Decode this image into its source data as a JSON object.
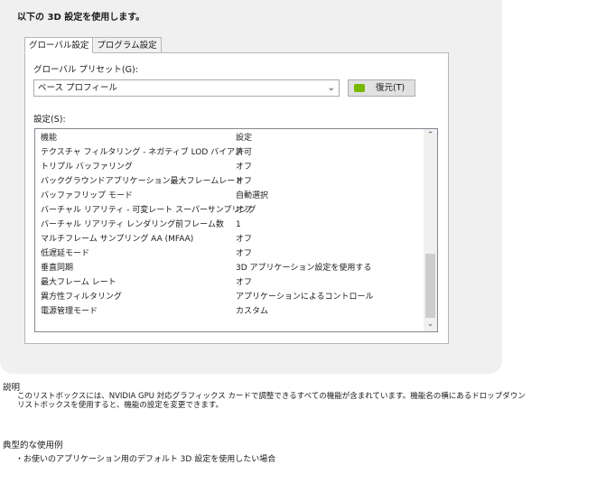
{
  "heading": "以下の 3D 設定を使用します。",
  "tabs": [
    {
      "label": "グローバル設定",
      "active": true
    },
    {
      "label": "プログラム設定",
      "active": false
    }
  ],
  "preset": {
    "label": "グローバル プリセット(G):",
    "selected": "ベース プロフィール",
    "restore_label": "復元(T)"
  },
  "settings": {
    "label": "設定(S):",
    "columns": [
      "機能",
      "設定"
    ],
    "rows": [
      {
        "feature": "テクスチャ フィルタリング - ネガティブ LOD バイアス",
        "value": "許可"
      },
      {
        "feature": "トリプル バッファリング",
        "value": "オフ"
      },
      {
        "feature": "バックグラウンドアプリケーション最大フレームレート",
        "value": "オフ"
      },
      {
        "feature": "バッファフリップ モード",
        "value": "自動選択"
      },
      {
        "feature": "バーチャル リアリティ - 可変レート スーパーサンプリング",
        "value": "オフ"
      },
      {
        "feature": "バーチャル リアリティ レンダリング前フレーム数",
        "value": "1"
      },
      {
        "feature": "マルチフレーム サンプリング AA (MFAA)",
        "value": "オフ"
      },
      {
        "feature": "低遅延モード",
        "value": "オフ"
      },
      {
        "feature": "垂直同期",
        "value": "3D アプリケーション設定を使用する"
      },
      {
        "feature": "最大フレーム レート",
        "value": "オフ"
      },
      {
        "feature": "異方性フィルタリング",
        "value": "アプリケーションによるコントロール"
      },
      {
        "feature": "電源管理モード",
        "value": "カスタム"
      }
    ]
  },
  "description": {
    "title": "説明",
    "text": "このリストボックスには、NVIDIA GPU 対応グラフィックス カードで調整できるすべての機能が含まれています。機能名の横にあるドロップダウン リストボックスを使用すると、機能の設定を変更できます。"
  },
  "usage": {
    "title": "典型的な使用例",
    "item": "・お使いのアプリケーション用のデフォルト 3D 設定を使用したい場合"
  },
  "icons": {
    "restore": "nvidia-logo-icon",
    "combo_arrow": "chevron-down-icon",
    "scroll_up": "scroll-up-arrow-icon",
    "scroll_down": "scroll-down-arrow-icon"
  },
  "colors": {
    "accent": "#76b900",
    "panel_bg": "#f0f0f0"
  }
}
